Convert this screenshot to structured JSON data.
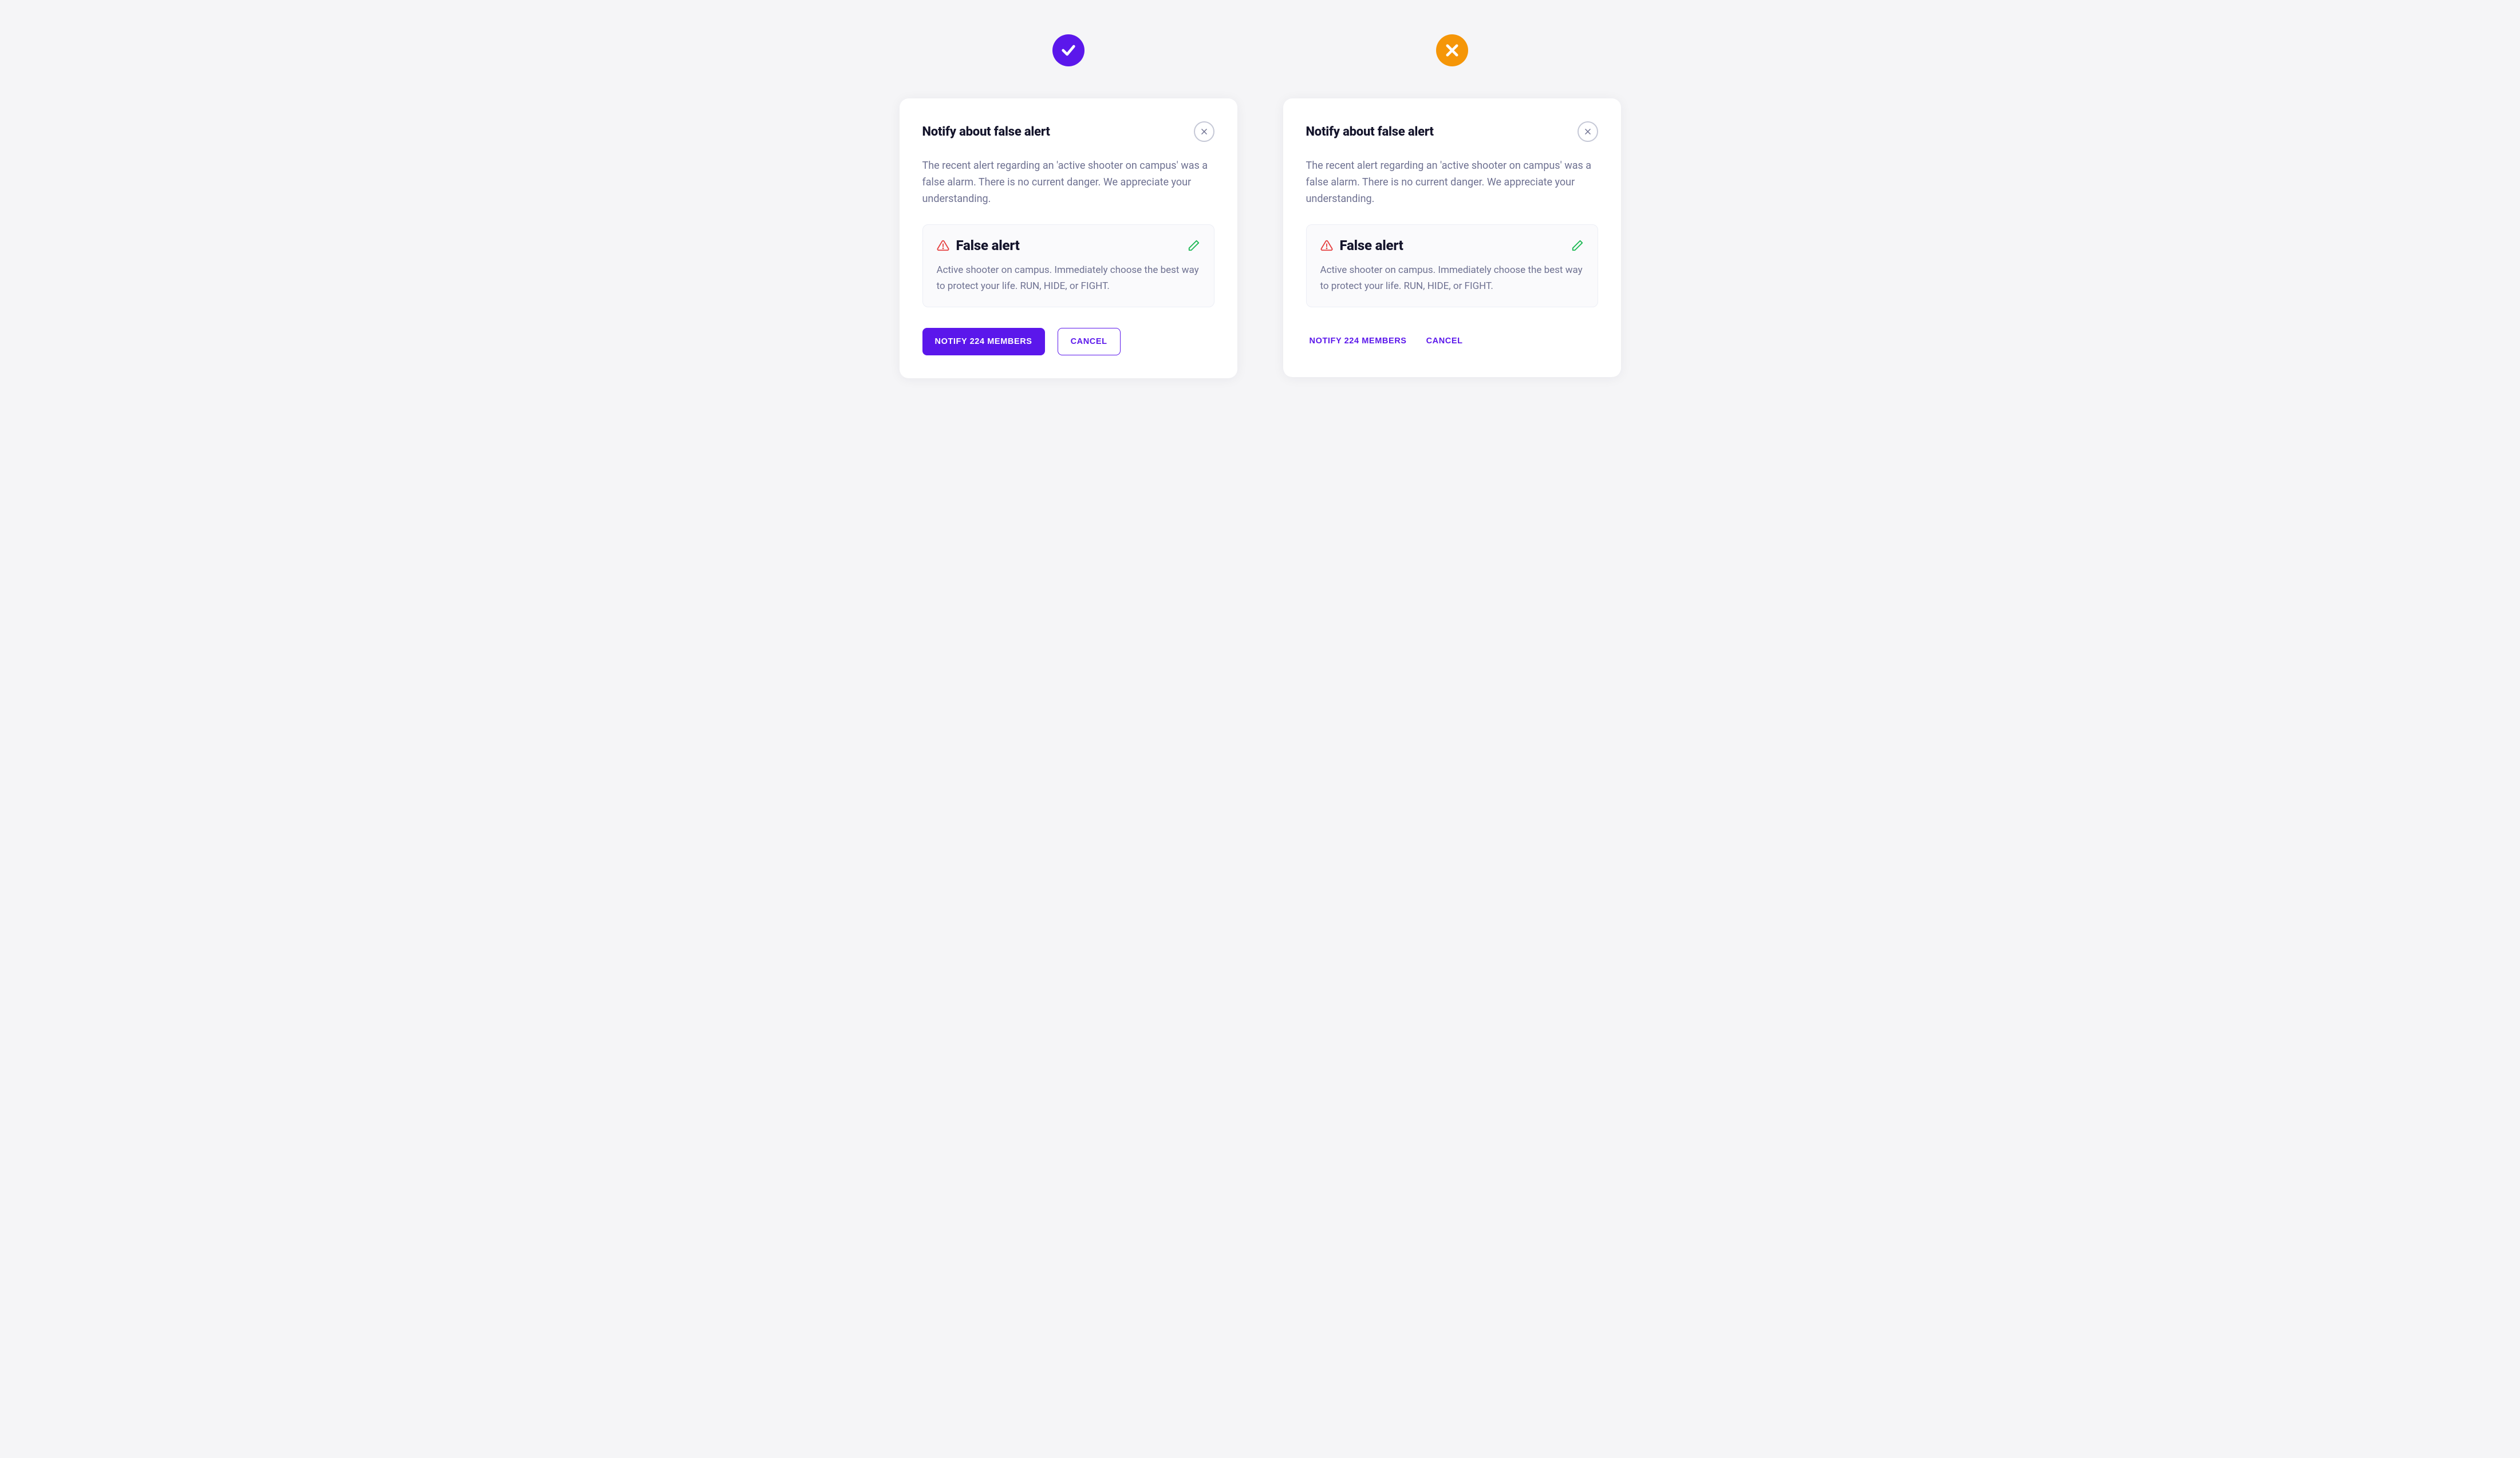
{
  "badges": {
    "good_color": "#5b17eb",
    "bad_color": "#f59608"
  },
  "dialog": {
    "title": "Notify about false alert",
    "body": "The recent alert regarding an 'active shooter on campus' was a false alarm. There is no current danger. We appreciate your understanding.",
    "alert": {
      "label": "False alert",
      "description": "Active shooter on campus. Immediately choose the best way to protect your life. RUN, HIDE, or FIGHT."
    },
    "actions": {
      "primary": "NOTIFY 224 MEMBERS",
      "secondary": "CANCEL"
    }
  }
}
